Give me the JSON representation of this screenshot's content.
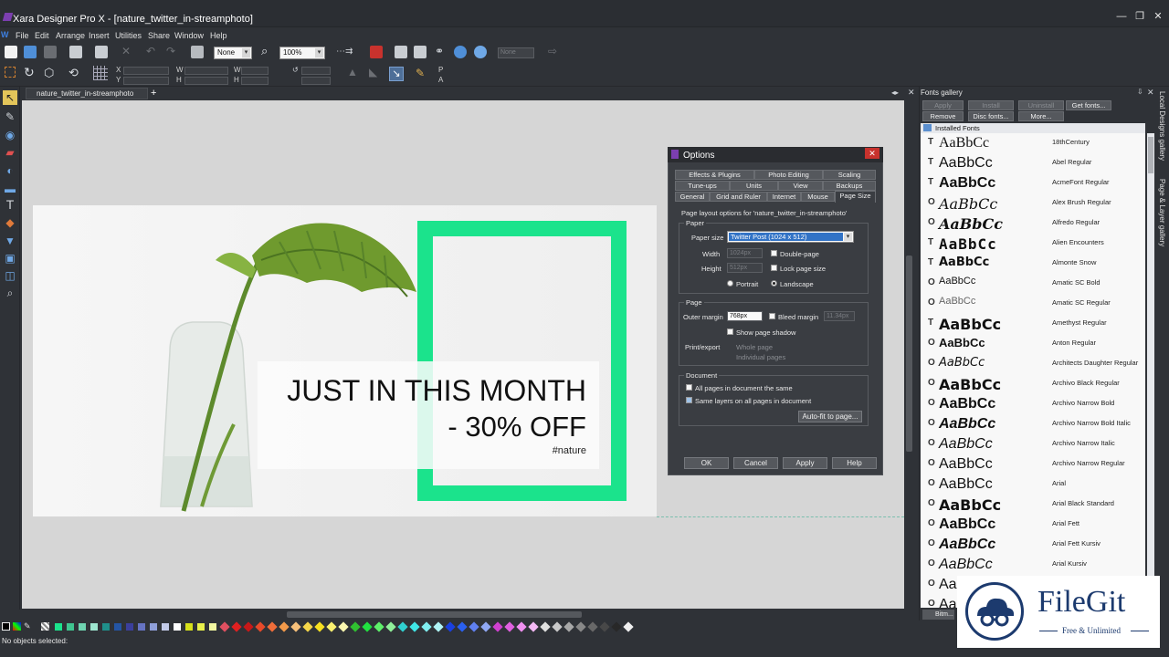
{
  "window": {
    "title": "Xara Designer Pro X - [nature_twitter_in-streamphoto]"
  },
  "menu": [
    "File",
    "Edit",
    "Arrange",
    "Insert",
    "Utilities",
    "Share",
    "Window",
    "Help"
  ],
  "toolbar": {
    "quality_value": "None",
    "zoom_value": "100%",
    "name_placeholder": "None"
  },
  "selector_bar": {
    "x_label": "X",
    "y_label": "Y",
    "w_label": "W",
    "h_label": "H",
    "p_label": "P",
    "a_label": "A"
  },
  "doc_tab": {
    "name": "nature_twitter_in-streamphoto",
    "add": "+"
  },
  "design": {
    "headline_line1": "JUST IN THIS MONTH",
    "headline_line2": "- 30% OFF",
    "hashtag": "#nature",
    "frame_color": "#1be38c"
  },
  "options_dialog": {
    "title": "Options",
    "tabs_row1": [
      "Effects & Plugins",
      "Photo Editing",
      "Scaling"
    ],
    "tabs_row2": [
      "Tune-ups",
      "Units",
      "View",
      "Backups"
    ],
    "tabs_row3": [
      "General",
      "Grid and Ruler",
      "Internet",
      "Mouse",
      "Page Size"
    ],
    "description": "Page layout options for 'nature_twitter_in-streamphoto'",
    "paper_group": "Paper",
    "paper_size_label": "Paper size",
    "paper_size_value": "Twitter Post (1024 x 512)",
    "width_label": "Width",
    "width_value": "1024px",
    "height_label": "Height",
    "height_value": "512px",
    "double_page": "Double-page",
    "lock_page_size": "Lock page size",
    "portrait": "Portrait",
    "landscape": "Landscape",
    "page_group": "Page",
    "outer_margin_label": "Outer margin",
    "outer_margin_value": "768px",
    "bleed_margin_label": "Bleed margin",
    "bleed_margin_value": "11.34px",
    "show_page_shadow": "Show page shadow",
    "print_export_label": "Print/export",
    "whole_page": "Whole page",
    "individual_pages": "Individual pages",
    "document_group": "Document",
    "all_pages_same": "All pages in document the same",
    "same_layers": "Same layers on all pages in document",
    "auto_fit": "Auto-fit to page...",
    "ok": "OK",
    "cancel": "Cancel",
    "apply": "Apply",
    "help": "Help"
  },
  "fonts_gallery": {
    "title": "Fonts gallery",
    "buttons_row1": [
      "Apply",
      "Install",
      "Uninstall",
      "Get fonts..."
    ],
    "buttons_row2": [
      "Remove",
      "Disc fonts...",
      "More..."
    ],
    "folder": "Installed Fonts",
    "sample": "AaBbCc",
    "fonts": [
      {
        "name": "18thCentury",
        "type": "T"
      },
      {
        "name": "Abel Regular",
        "type": "T"
      },
      {
        "name": "AcmeFont Regular",
        "type": "T"
      },
      {
        "name": "Alex Brush Regular",
        "type": "O"
      },
      {
        "name": "Alfredo Regular",
        "type": "O"
      },
      {
        "name": "Alien Encounters",
        "type": "T"
      },
      {
        "name": "Almonte Snow",
        "type": "T"
      },
      {
        "name": "Amatic SC Bold",
        "type": "O"
      },
      {
        "name": "Amatic SC Regular",
        "type": "O"
      },
      {
        "name": "Amethyst Regular",
        "type": "T"
      },
      {
        "name": "Anton Regular",
        "type": "O"
      },
      {
        "name": "Architects Daughter Regular",
        "type": "O"
      },
      {
        "name": "Archivo Black Regular",
        "type": "O"
      },
      {
        "name": "Archivo Narrow Bold",
        "type": "O"
      },
      {
        "name": "Archivo Narrow Bold Italic",
        "type": "O"
      },
      {
        "name": "Archivo Narrow Italic",
        "type": "O"
      },
      {
        "name": "Archivo Narrow Regular",
        "type": "O"
      },
      {
        "name": "Arial",
        "type": "O"
      },
      {
        "name": "Arial Black Standard",
        "type": "O"
      },
      {
        "name": "Arial Fett",
        "type": "O"
      },
      {
        "name": "Arial Fett Kursiv",
        "type": "O"
      },
      {
        "name": "Arial Kursiv",
        "type": "O"
      },
      {
        "name": "",
        "type": "O"
      },
      {
        "name": "",
        "type": "O"
      }
    ],
    "bottom_tab": "Bitm..."
  },
  "side_tabs": [
    "Local Designs gallery",
    "Page & Layer gallery"
  ],
  "status": {
    "text": "No objects selected:"
  },
  "watermark": {
    "title": "FileGit",
    "subtitle": "Free & Unlimited"
  }
}
